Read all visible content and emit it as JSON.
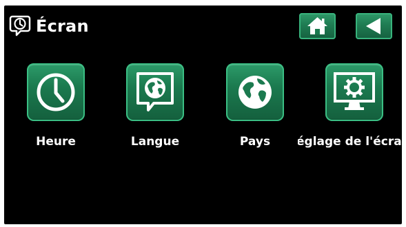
{
  "header": {
    "title": "Écran",
    "icon": "display-settings-icon"
  },
  "nav": {
    "home_icon": "home-icon",
    "back_icon": "back-arrow-icon"
  },
  "tiles": [
    {
      "label": "Heure",
      "icon": "clock-icon"
    },
    {
      "label": "Langue",
      "icon": "globe-speech-bubble-icon"
    },
    {
      "label": "Pays",
      "icon": "globe-icon"
    },
    {
      "label": "églage de l'écra",
      "icon": "monitor-gear-icon"
    }
  ],
  "colors": {
    "background": "#000000",
    "tile_green": "#1f7c52",
    "tile_border": "#3bbf84",
    "text": "#ffffff"
  }
}
